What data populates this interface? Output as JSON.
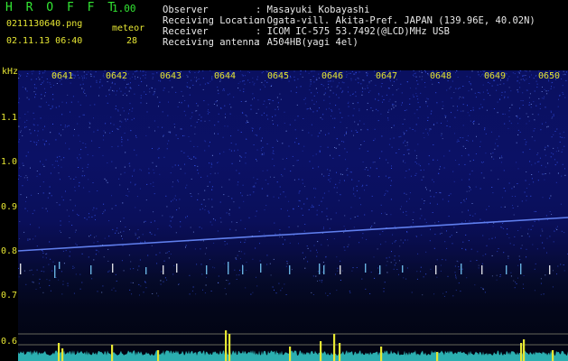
{
  "header": {
    "title": "H R O F F T",
    "version": "1.00",
    "filename": "0211130640.png",
    "meteor_label": "meteor",
    "datetime": "02.11.13 06:40",
    "meteor_count": "28"
  },
  "station_info": [
    {
      "label": "Observer",
      "value": ": Masayuki Kobayashi"
    },
    {
      "label": "Receiving Location",
      "value": ": Ogata-vill. Akita-Pref. JAPAN (139.96E, 40.02N)"
    },
    {
      "label": "Receiver",
      "value": ": ICOM IC-575 53.7492(@LCD)MHz USB"
    },
    {
      "label": "Receiving antenna",
      "value": ": A504HB(yagi 4el)"
    }
  ],
  "spectrogram": {
    "y_unit": "kHz",
    "x_ticks": [
      "0641",
      "0642",
      "0643",
      "0644",
      "0645",
      "0646",
      "0647",
      "0648",
      "0649",
      "0650"
    ],
    "y_ticks": [
      "1.1",
      "1.0",
      "0.9",
      "0.8",
      "0.7",
      "0.6"
    ],
    "y_range_khz": [
      0.575,
      1.185
    ],
    "x_range_min": [
      0,
      10
    ],
    "background_color": "#0a1060",
    "noise_color": "#3a5cff",
    "carrier_color": "#6a8cff",
    "level_color": "#33cccc",
    "peak_color": "#e6e633"
  }
}
